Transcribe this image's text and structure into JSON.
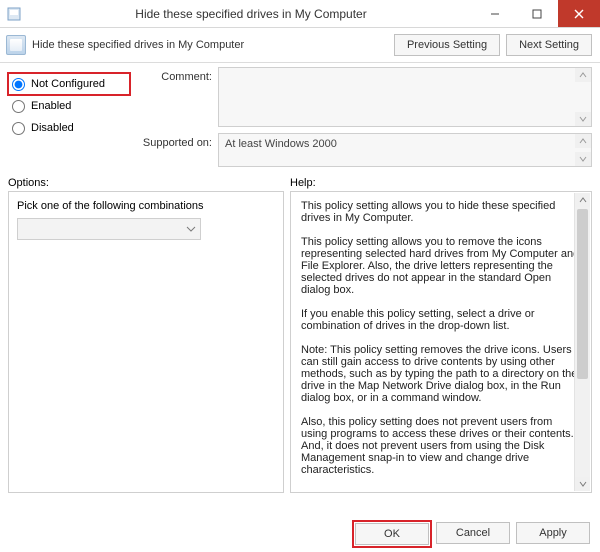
{
  "window": {
    "title": "Hide these specified drives in My Computer"
  },
  "header": {
    "policy_title": "Hide these specified drives in My Computer",
    "prev_btn": "Previous Setting",
    "next_btn": "Next Setting"
  },
  "radios": {
    "not_configured": "Not Configured",
    "enabled": "Enabled",
    "disabled": "Disabled",
    "selected": "not_configured"
  },
  "fields": {
    "comment_label": "Comment:",
    "comment_value": "",
    "supported_label": "Supported on:",
    "supported_value": "At least Windows 2000"
  },
  "labels": {
    "options": "Options:",
    "help": "Help:"
  },
  "options_panel": {
    "instruction": "Pick one of the following combinations"
  },
  "help_text": {
    "p1": "This policy setting allows you to hide these specified drives in My Computer.",
    "p2": "This policy setting allows you to remove the icons representing selected hard drives from My Computer and File Explorer. Also, the drive letters representing the selected drives do not appear in the standard Open dialog box.",
    "p3": "If you enable this policy setting, select a drive or combination of drives in the drop-down list.",
    "p4": "Note: This policy setting removes the drive icons. Users can still gain access to drive contents by using other methods, such as by typing the path to a directory on the drive in the Map Network Drive dialog box, in the Run dialog box, or in a command window.",
    "p5": "Also, this policy setting does not prevent users from using programs to access these drives or their contents. And, it does not prevent users from using the Disk Management snap-in to view and change drive characteristics."
  },
  "footer": {
    "ok": "OK",
    "cancel": "Cancel",
    "apply": "Apply"
  }
}
